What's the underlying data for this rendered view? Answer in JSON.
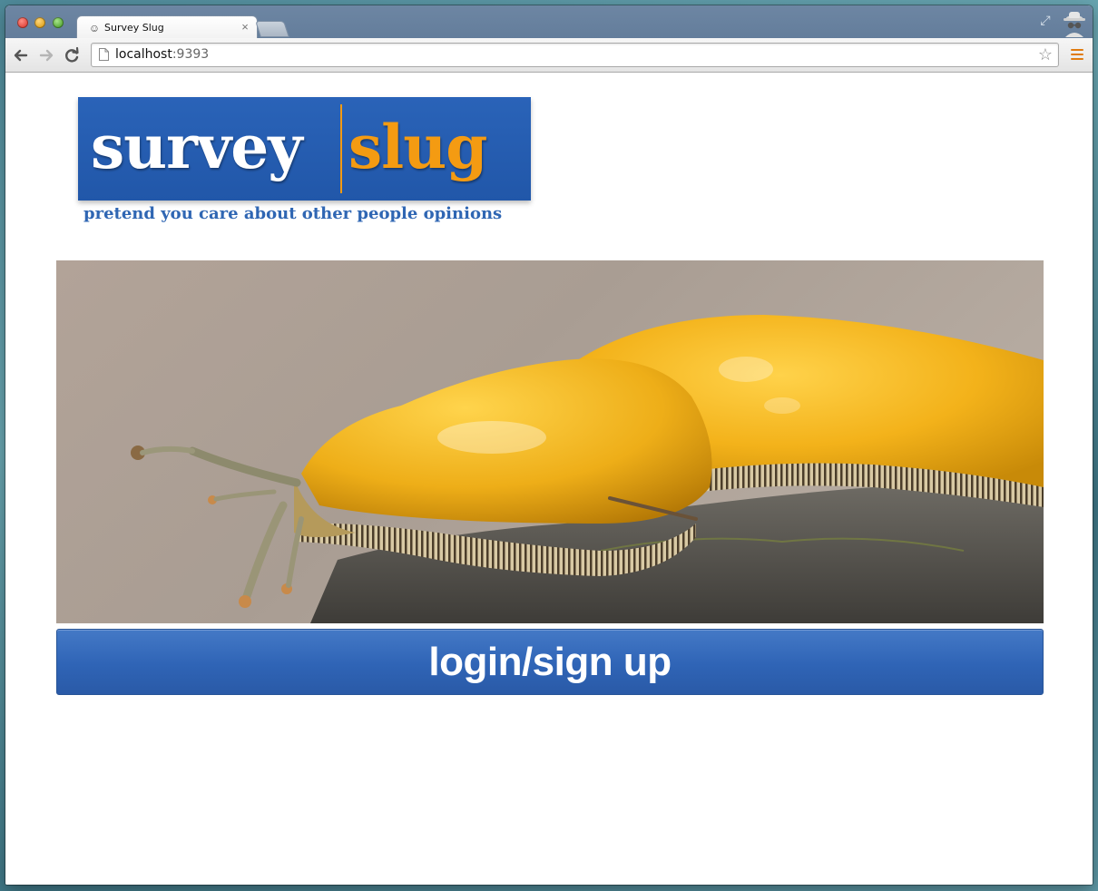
{
  "browser": {
    "tab_title": "Survey Slug",
    "url_host": "localhost",
    "url_port": ":9393"
  },
  "logo": {
    "word_left": "survey",
    "word_right": "slug",
    "tagline": "pretend you care about other people opinions",
    "colors": {
      "background": "#2a63b8",
      "accent": "#f49b12",
      "text": "#ffffff",
      "tagline": "#2f66b3"
    }
  },
  "hero": {
    "icon": "banana-slug-photo"
  },
  "login_button": {
    "label": "login/sign up",
    "color": "#2f64b6"
  },
  "icons": {
    "back": "back-arrow-icon",
    "forward": "forward-arrow-icon",
    "reload": "reload-icon",
    "bookmark": "star-icon",
    "menu": "menu-icon",
    "incognito": "incognito-icon"
  }
}
